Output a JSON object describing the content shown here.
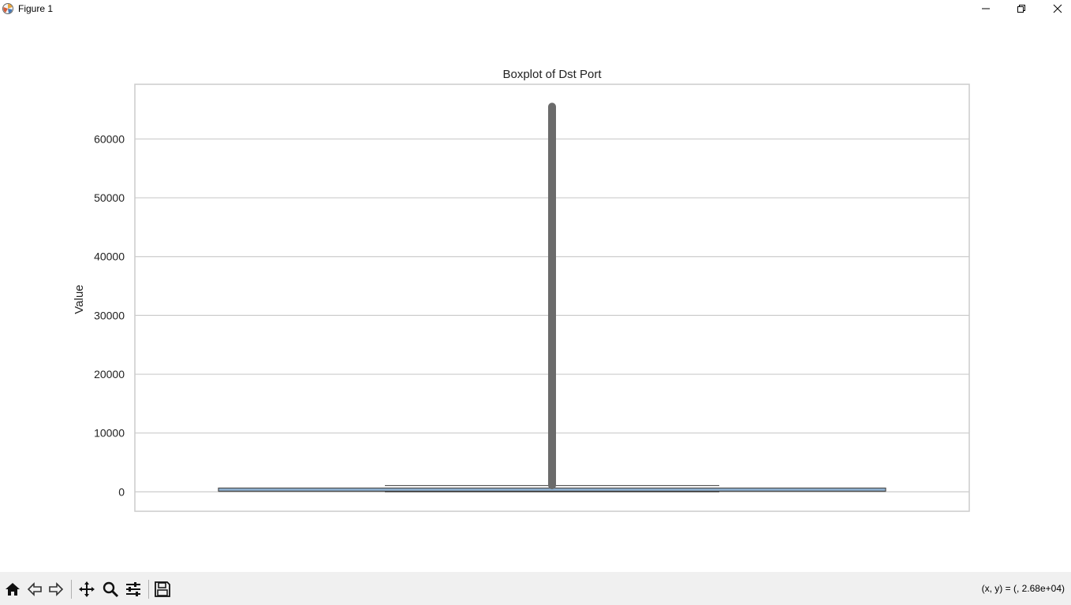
{
  "window": {
    "title": "Figure 1",
    "controls": [
      "minimize-icon",
      "restore-icon",
      "close-icon"
    ]
  },
  "toolbar": {
    "tools": [
      "home-icon",
      "back-icon",
      "forward-icon",
      "pan-icon",
      "zoom-icon",
      "configure-subplots-icon",
      "save-icon"
    ],
    "coordinate_readout": "(x, y) = (, 2.68e+04)"
  },
  "colors": {
    "grid": "#cccccc",
    "axes_border": "#cccccc",
    "box_fill": "#8fb2d3",
    "box_edge": "#4f4f4f",
    "outliers": "#6b6b6b",
    "toolbar_bg": "#f0f0f0"
  },
  "chart_data": {
    "type": "box",
    "title": "Boxplot of Dst Port",
    "xlabel": "",
    "ylabel": "Value",
    "ylim": [
      -3300,
      69300
    ],
    "yticks": [
      0,
      10000,
      20000,
      30000,
      40000,
      50000,
      60000
    ],
    "ytick_labels": [
      "0",
      "10000",
      "20000",
      "30000",
      "40000",
      "50000",
      "60000"
    ],
    "grid": true,
    "box": {
      "q1": 53,
      "median": 80,
      "q3": 443,
      "whisker_low": 0,
      "whisker_high": 1060
    },
    "outliers": {
      "min": 1100,
      "max": 65500
    }
  }
}
